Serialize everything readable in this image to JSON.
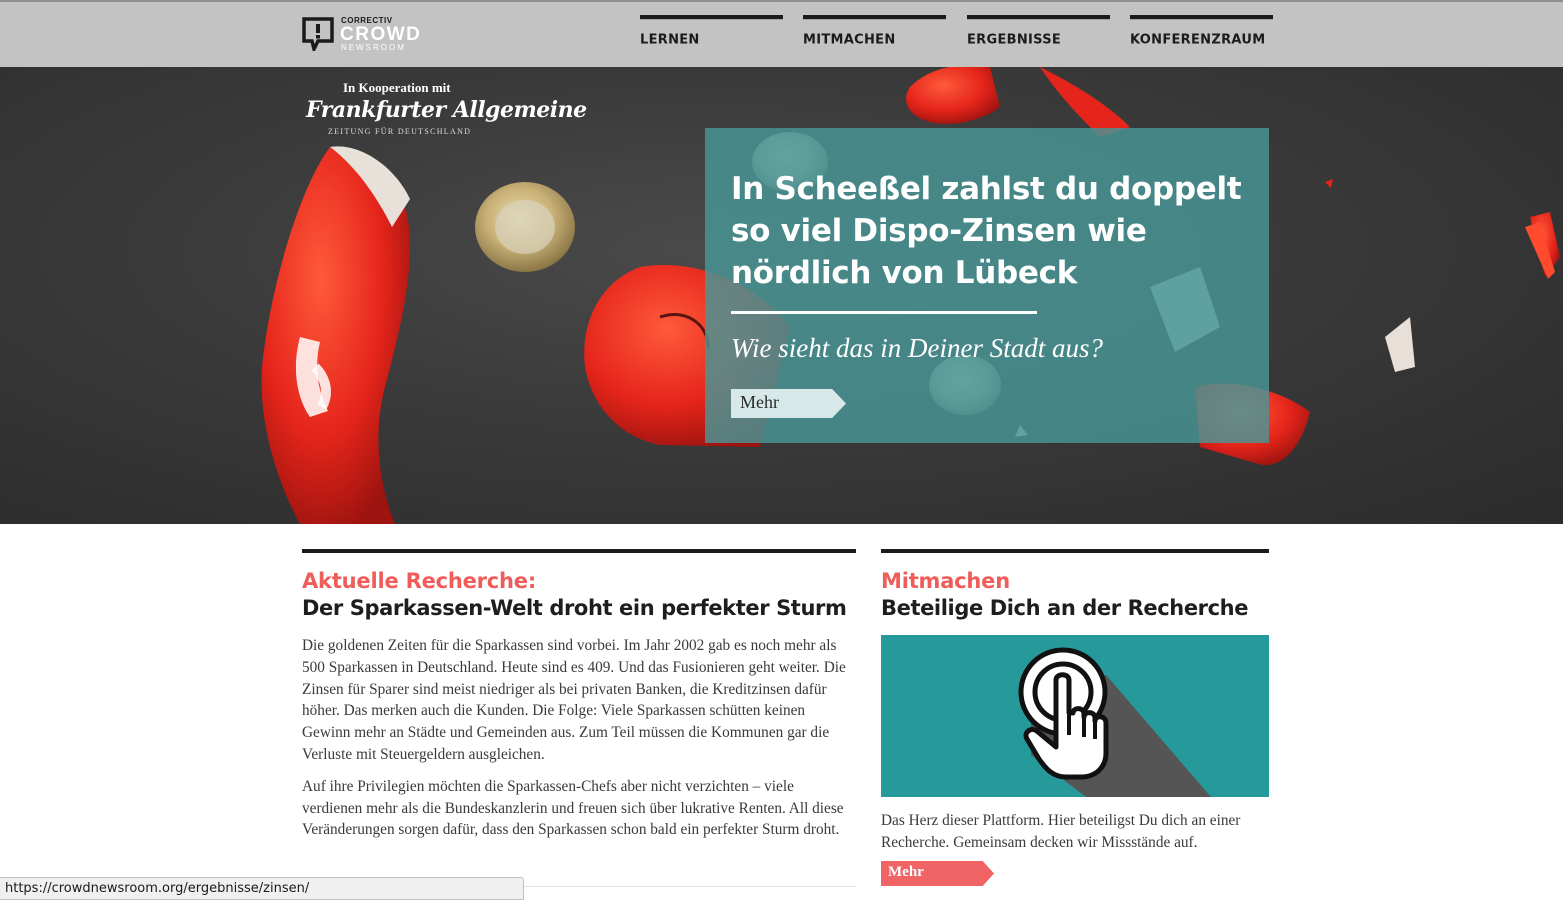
{
  "header": {
    "logo_small": "CORRECTIV",
    "logo_big": "CROWD",
    "logo_sub": "NEWSROOM",
    "nav": [
      {
        "label": "LERNEN"
      },
      {
        "label": "MITMACHEN"
      },
      {
        "label": "ERGEBNISSE"
      },
      {
        "label": "KONFERENZRAUM"
      }
    ]
  },
  "hero": {
    "cooperation": "In Kooperation mit",
    "partner_name": "Frankfurter Allgemeine",
    "partner_tagline": "ZEITUNG FÜR DEUTSCHLAND",
    "title": "In Scheeßel zahlst du doppelt so viel Dispo-Zinsen wie nördlich von Lübeck",
    "subtitle": "Wie sieht das in Deiner Stadt aus?",
    "button": "Mehr"
  },
  "recherche": {
    "kicker": "Aktuelle Recherche:",
    "headline": "Der Sparkassen-Welt droht ein perfekter Sturm",
    "paragraph1": "Die goldenen Zeiten für die Sparkassen sind vorbei. Im Jahr 2002 gab es noch mehr als 500 Sparkassen in Deutschland. Heute sind es 409. Und das Fusionieren geht weiter. Die Zinsen für Sparer sind meist niedriger als bei privaten Banken, die Kreditzinsen dafür höher. Das merken auch die Kunden. Die Folge: Viele Sparkassen schütten keinen Gewinn mehr an Städte und Gemeinden aus. Zum Teil müssen die Kommunen gar die Verluste mit Steuergeldern ausgleichen.",
    "paragraph2": "Auf ihre Privilegien möchten die Sparkassen-Chefs aber nicht verzichten – viele verdienen mehr als die Bundeskanzlerin und freuen sich über lukrative Renten. All diese Veränderungen sorgen dafür, dass den Sparkassen schon bald ein perfekter Sturm droht."
  },
  "mitmachen": {
    "kicker": "Mitmachen",
    "headline": "Beteilige Dich an der Recherche",
    "text": "Das Herz dieser Plattform. Hier beteiligst Du dich an einer Recherche. Gemeinsam decken wir Missstände auf.",
    "button": "Mehr",
    "icon": "touch-hand-icon"
  },
  "status_url": "https://crowdnewsroom.org/ergebnisse/zinsen/",
  "colors": {
    "accent": "#f05c5a",
    "teal": "#26999b",
    "teaser_overlay": "#48969699",
    "nav_bg": "#c3c3c3"
  }
}
